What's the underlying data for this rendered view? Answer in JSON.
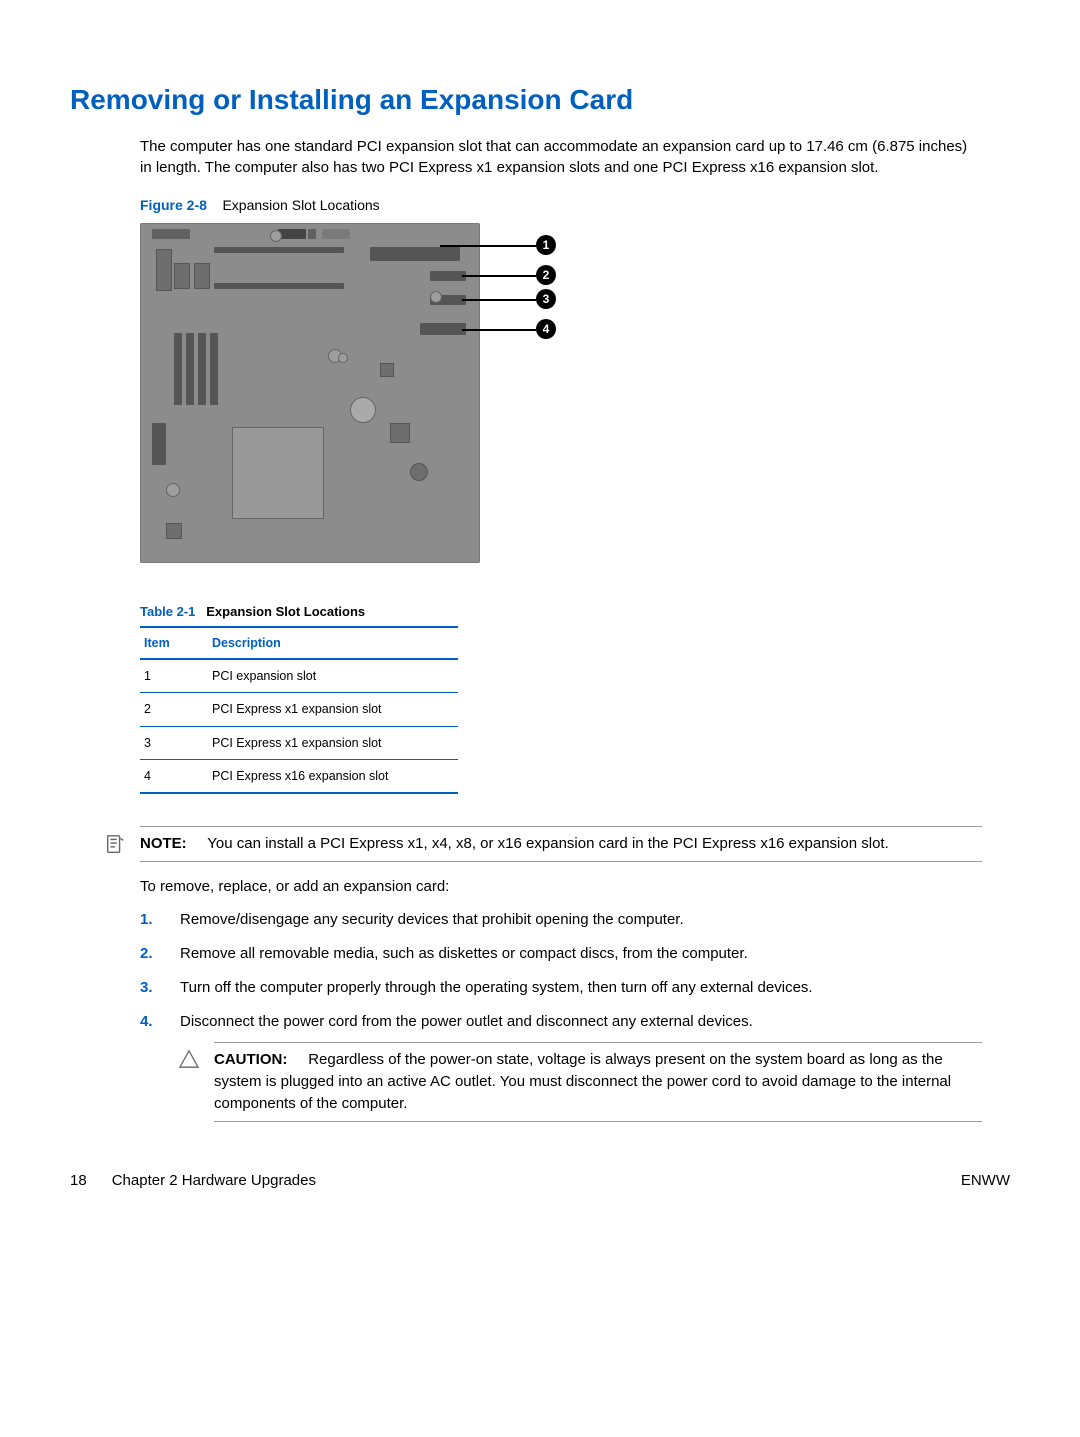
{
  "heading": "Removing or Installing an Expansion Card",
  "intro": "The computer has one standard PCI expansion slot that can accommodate an expansion card up to 17.46 cm (6.875 inches) in length. The computer also has two PCI Express x1 expansion slots and one PCI Express x16 expansion slot.",
  "figure": {
    "label": "Figure 2-8",
    "title": "Expansion Slot Locations",
    "callouts": [
      "1",
      "2",
      "3",
      "4"
    ]
  },
  "table": {
    "label": "Table 2-1",
    "title": "Expansion Slot Locations",
    "columns": [
      "Item",
      "Description"
    ],
    "rows": [
      {
        "item": "1",
        "desc": "PCI expansion slot"
      },
      {
        "item": "2",
        "desc": "PCI Express x1 expansion slot"
      },
      {
        "item": "3",
        "desc": "PCI Express x1 expansion slot"
      },
      {
        "item": "4",
        "desc": "PCI Express x16 expansion slot"
      }
    ]
  },
  "note": {
    "label": "NOTE:",
    "text": "You can install a PCI Express x1, x4, x8, or x16 expansion card in the PCI Express x16 expansion slot."
  },
  "lead_in": "To remove, replace, or add an expansion card:",
  "steps": [
    {
      "num": "1.",
      "text": "Remove/disengage any security devices that prohibit opening the computer."
    },
    {
      "num": "2.",
      "text": "Remove all removable media, such as diskettes or compact discs, from the computer."
    },
    {
      "num": "3.",
      "text": "Turn off the computer properly through the operating system, then turn off any external devices."
    },
    {
      "num": "4.",
      "text": "Disconnect the power cord from the power outlet and disconnect any external devices."
    }
  ],
  "caution": {
    "label": "CAUTION:",
    "text": "Regardless of the power-on state, voltage is always present on the system board as long as the system is plugged into an active AC outlet. You must disconnect the power cord to avoid damage to the internal components of the computer."
  },
  "footer": {
    "page": "18",
    "chapter": "Chapter 2   Hardware Upgrades",
    "right": "ENWW"
  }
}
